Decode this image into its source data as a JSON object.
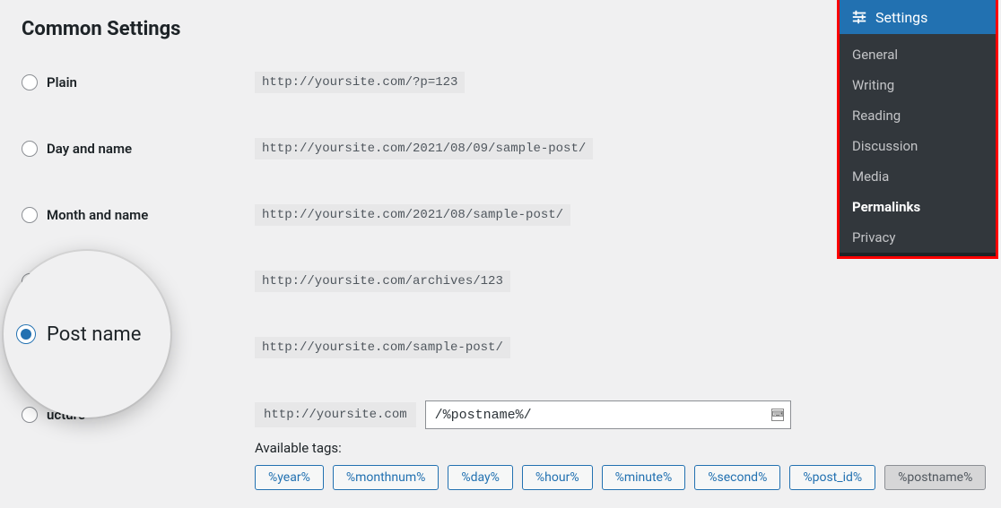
{
  "heading": "Common Settings",
  "options": {
    "plain": {
      "label": "Plain",
      "example": "http://yoursite.com/?p=123"
    },
    "dayname": {
      "label": "Day and name",
      "example": "http://yoursite.com/2021/08/09/sample-post/"
    },
    "monthname": {
      "label": "Month and name",
      "example": "http://yoursite.com/2021/08/sample-post/"
    },
    "numeric": {
      "label": "",
      "example": "http://yoursite.com/archives/123"
    },
    "postname": {
      "label": "Post name",
      "example": "http://yoursite.com/sample-post/"
    },
    "custom": {
      "label": "ucture",
      "prefix": "http://yoursite.com",
      "value": "/%postname%/"
    }
  },
  "tags_label": "Available tags:",
  "tags": [
    "%year%",
    "%monthnum%",
    "%day%",
    "%hour%",
    "%minute%",
    "%second%",
    "%post_id%",
    "%postname%"
  ],
  "active_tag": "%postname%",
  "spotlight": {
    "label": "Post name"
  },
  "sidebar": {
    "header": "Settings",
    "items": [
      "General",
      "Writing",
      "Reading",
      "Discussion",
      "Media",
      "Permalinks",
      "Privacy"
    ],
    "active": "Permalinks"
  }
}
